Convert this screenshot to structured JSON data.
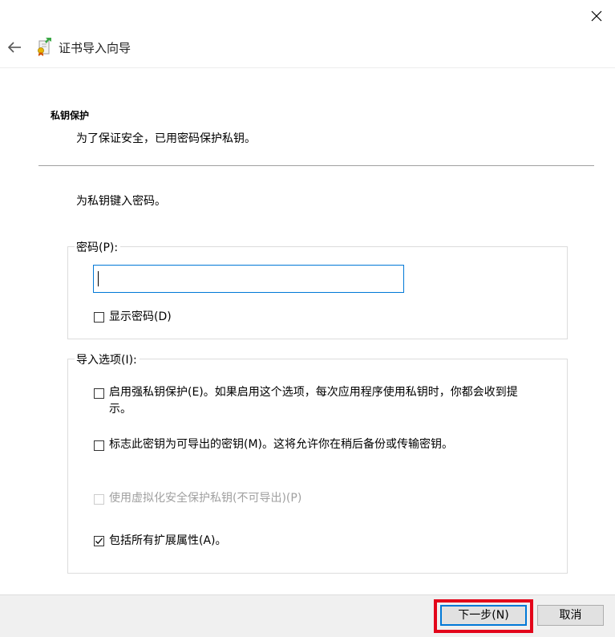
{
  "wizard": {
    "title": "证书导入向导"
  },
  "section": {
    "title": "私钥保护",
    "description": "为了保证安全，已用密码保护私钥。"
  },
  "prompt": "为私钥键入密码。",
  "password_group": {
    "legend": "密码(P):",
    "input_value": "",
    "show_password_label": "显示密码(D)",
    "show_password_checked": false
  },
  "options_group": {
    "legend": "导入选项(I):",
    "options": [
      {
        "label_line1": "启用强私钥保护(E)。如果启用这个选项，每次应用程序使用私钥时，你都会收到提",
        "label_line2": "示。",
        "checked": false,
        "enabled": true
      },
      {
        "label": "标志此密钥为可导出的密钥(M)。这将允许你在稍后备份或传输密钥。",
        "checked": false,
        "enabled": true
      },
      {
        "label": "使用虚拟化安全保护私钥(不可导出)(P)",
        "checked": false,
        "enabled": false
      },
      {
        "label": "包括所有扩展属性(A)。",
        "checked": true,
        "enabled": true
      }
    ]
  },
  "buttons": {
    "next": "下一步(N)",
    "cancel": "取消"
  },
  "colors": {
    "accent": "#0078d7",
    "highlight": "#e3051a",
    "footer": "#f0f0f0",
    "disabled_text": "#a0a0a0"
  },
  "icons": {
    "close": "close-icon",
    "back": "back-arrow-icon",
    "wizard": "certificate-icon",
    "check": "checkmark-icon"
  }
}
